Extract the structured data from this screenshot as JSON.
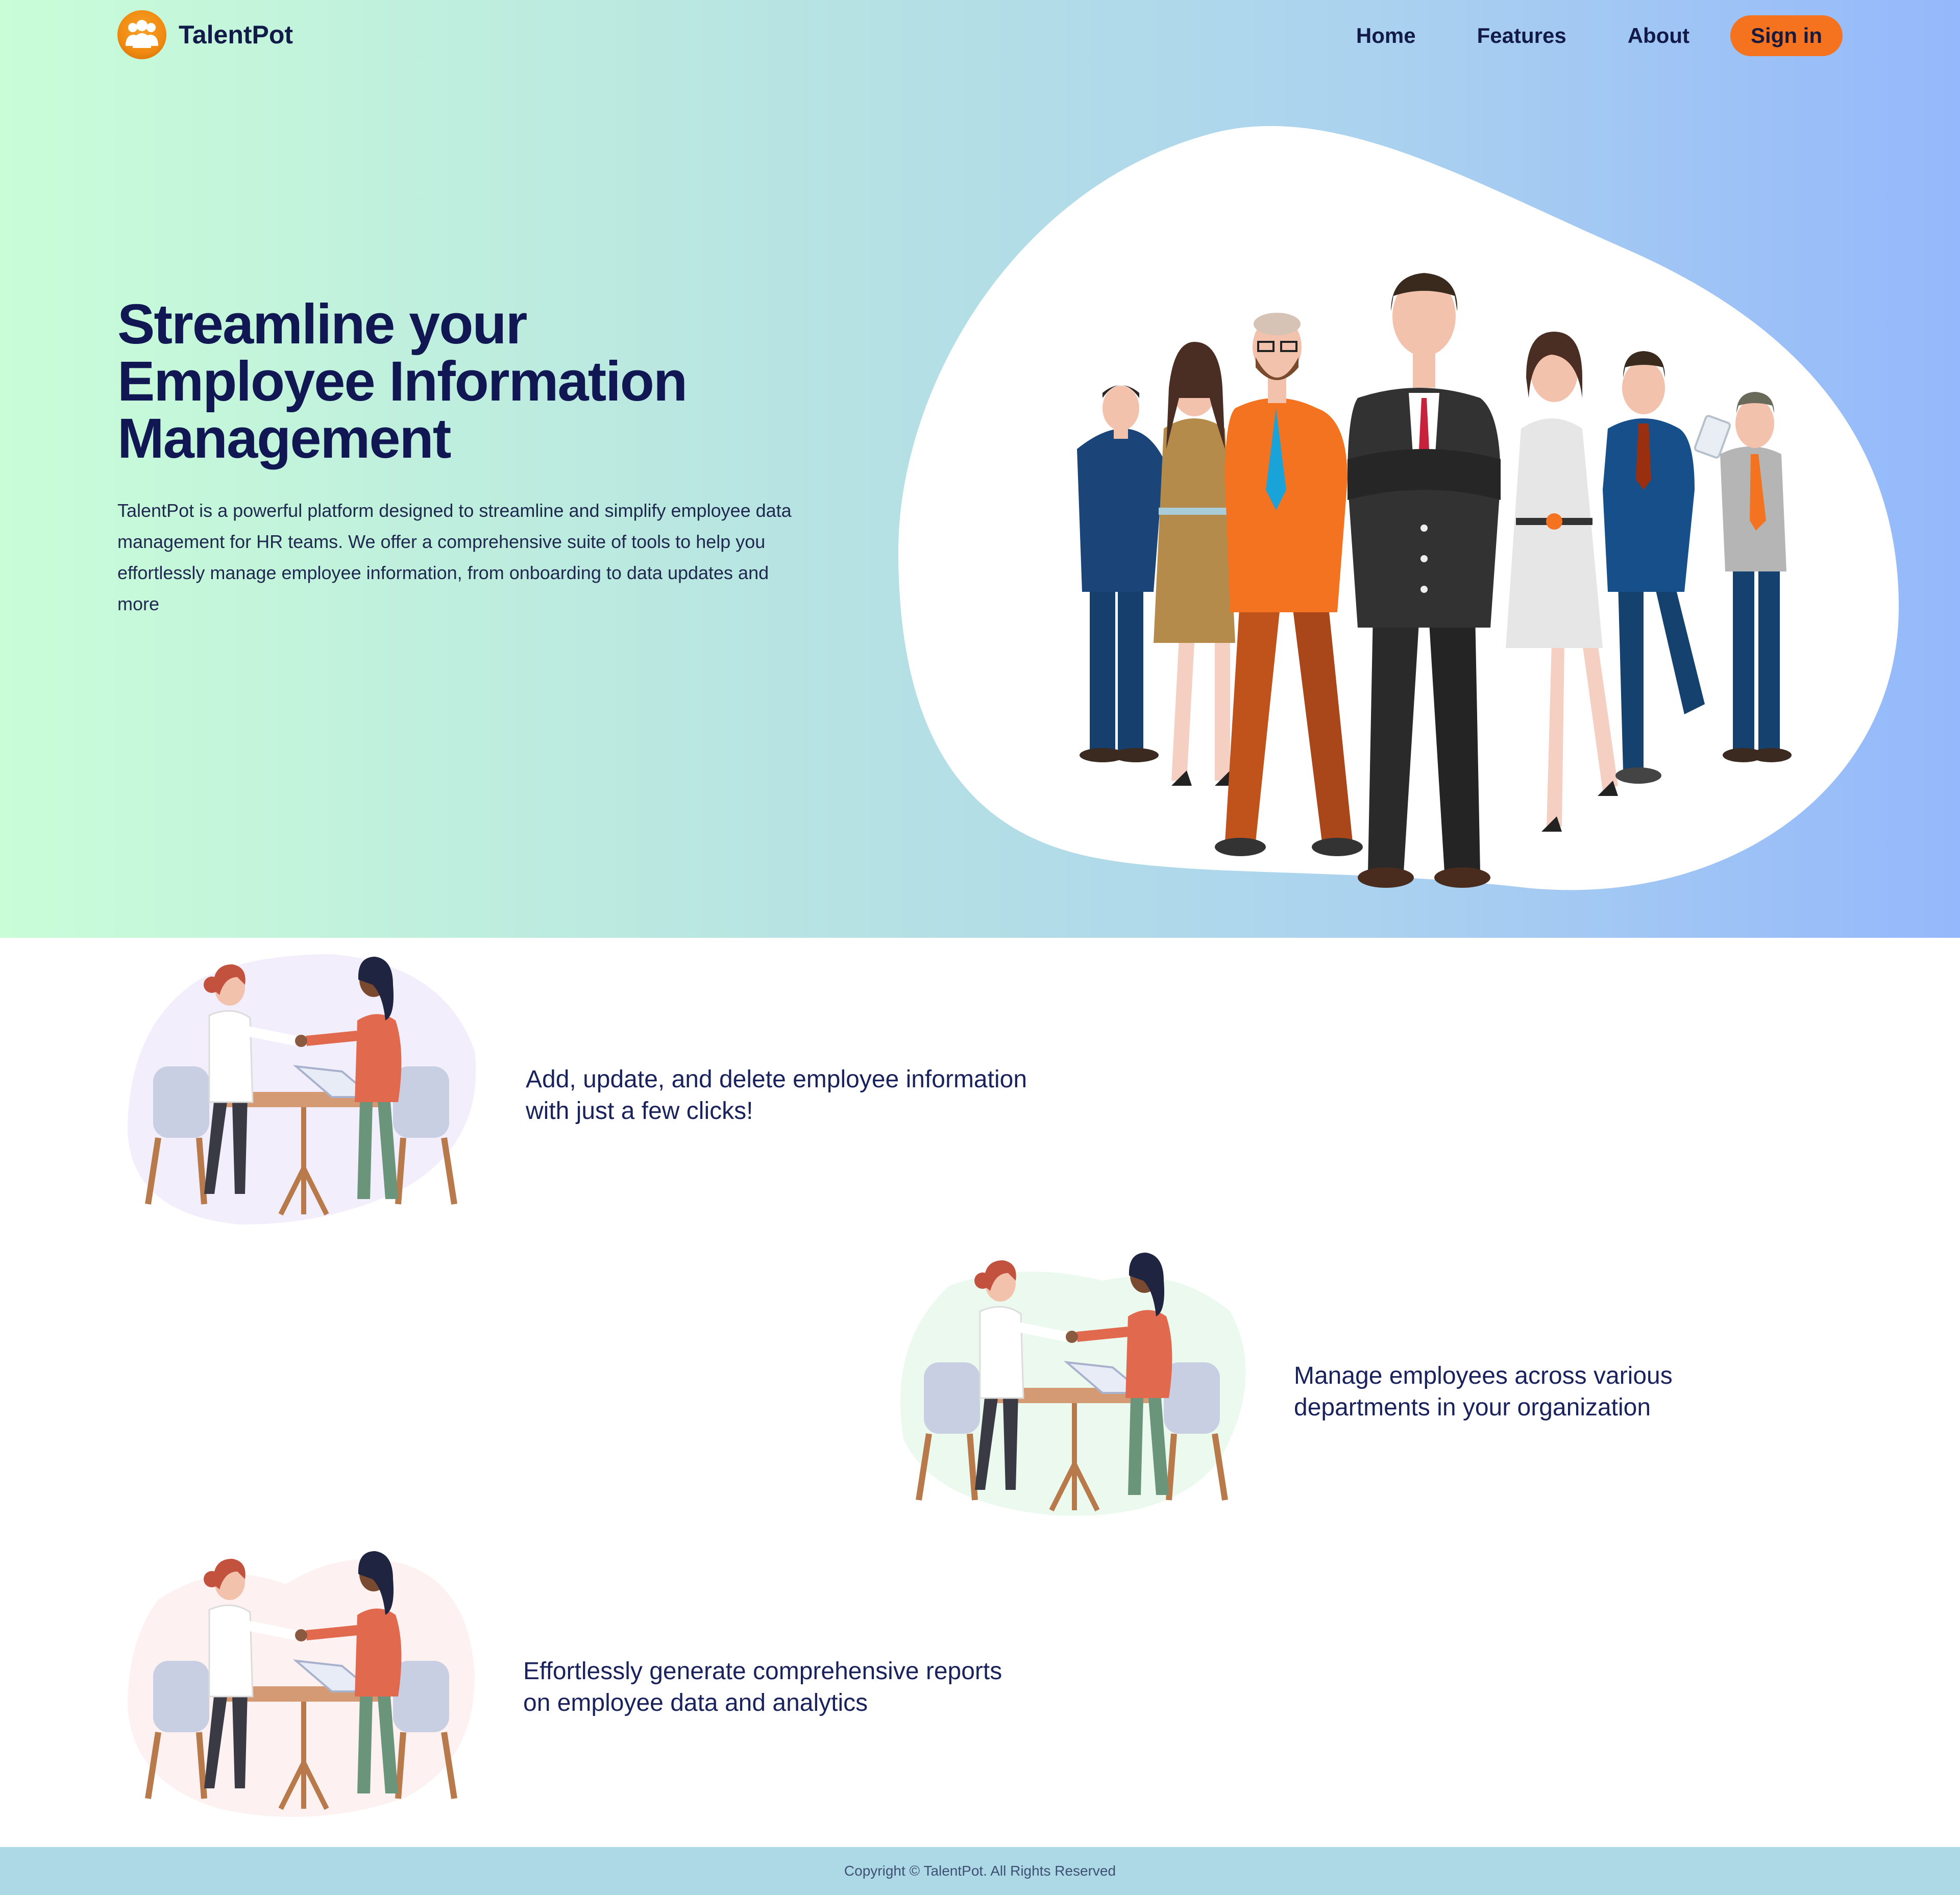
{
  "header": {
    "brand": "TalentPot",
    "logo_icon": "users-group-icon",
    "nav": [
      {
        "label": "Home"
      },
      {
        "label": "Features"
      },
      {
        "label": "About"
      }
    ],
    "signin_label": "Sign in"
  },
  "hero": {
    "title_lines": [
      "Streamline your",
      "Employee Information",
      "Management"
    ],
    "description": "TalentPot is a powerful platform designed to streamline and simplify employee data management for HR teams. We offer a comprehensive suite of tools to help you effortlessly manage employee information, from onboarding to data updates and more"
  },
  "features": [
    {
      "line1": "Add, update, and delete employee information",
      "line2": "with just a few clicks!",
      "blob_color": "#f3eefb"
    },
    {
      "line1": "Manage employees across various",
      "line2": "departments in your organization",
      "blob_color": "#ebf9ee"
    },
    {
      "line1": "Effortlessly generate comprehensive reports",
      "line2": "on employee data and analytics",
      "blob_color": "#fdf1f1"
    }
  ],
  "footer": {
    "copyright": "Copyright © TalentPot. All Rights Reserved"
  },
  "colors": {
    "accent": "#f5731f",
    "heading": "#111752",
    "footer_bg": "#add8e5"
  }
}
